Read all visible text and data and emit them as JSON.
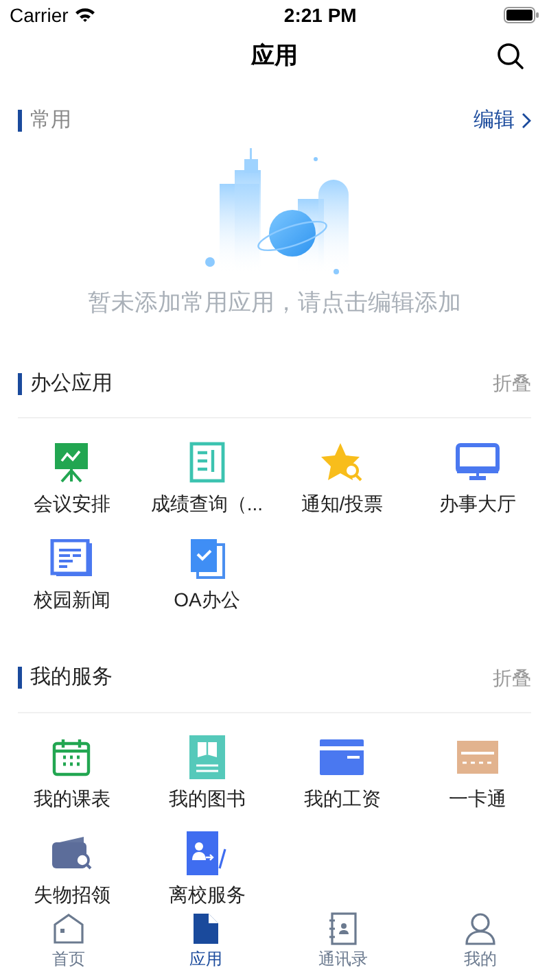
{
  "status_bar": {
    "carrier": "Carrier",
    "time": "2:21 PM"
  },
  "nav_bar": {
    "title": "应用"
  },
  "favorites": {
    "title": "常用",
    "action": "编辑",
    "empty_message": "暂未添加常用应用，请点击编辑添加"
  },
  "sections": [
    {
      "title": "办公应用",
      "action": "折叠",
      "apps": [
        {
          "label": "会议安排"
        },
        {
          "label": "成绩查询（..."
        },
        {
          "label": "通知/投票"
        },
        {
          "label": "办事大厅"
        },
        {
          "label": "校园新闻"
        },
        {
          "label": "OA办公"
        }
      ]
    },
    {
      "title": "我的服务",
      "action": "折叠",
      "apps": [
        {
          "label": "我的课表"
        },
        {
          "label": "我的图书"
        },
        {
          "label": "我的工资"
        },
        {
          "label": "一卡通"
        },
        {
          "label": "失物招领"
        },
        {
          "label": "离校服务"
        }
      ]
    }
  ],
  "tab_bar": [
    {
      "label": "首页",
      "selected": false
    },
    {
      "label": "应用",
      "selected": true
    },
    {
      "label": "通讯录",
      "selected": false
    },
    {
      "label": "我的",
      "selected": false
    }
  ]
}
